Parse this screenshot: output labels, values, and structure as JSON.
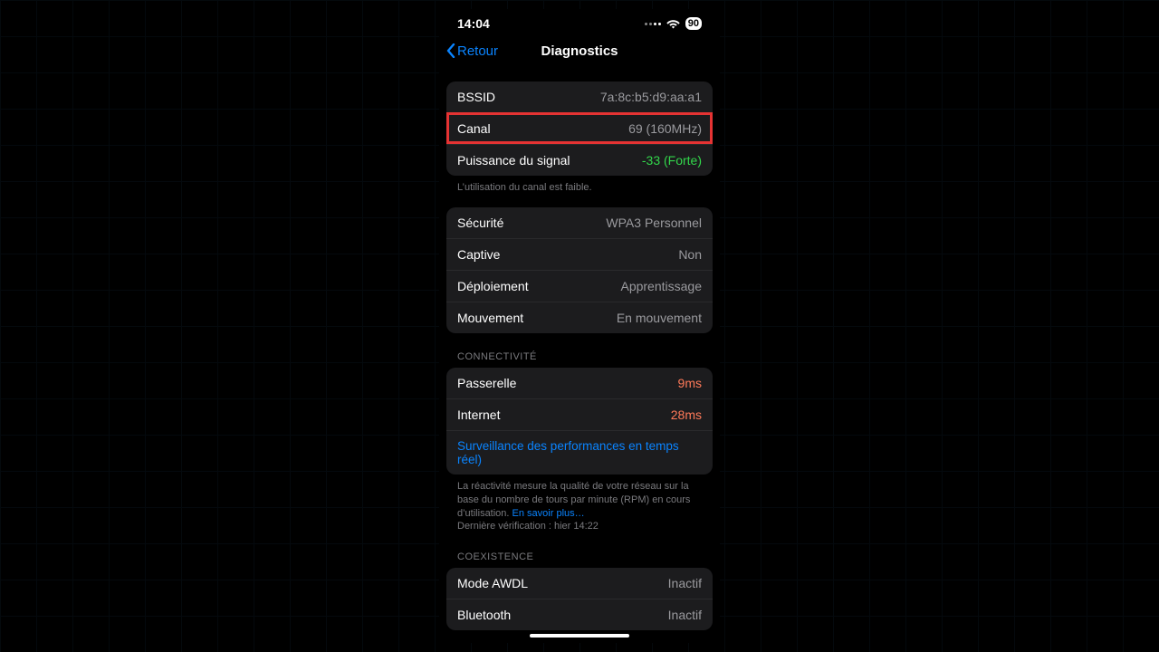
{
  "status": {
    "time": "14:04",
    "battery": "90"
  },
  "nav": {
    "back": "Retour",
    "title": "Diagnostics"
  },
  "group1": {
    "rows": [
      {
        "label": "BSSID",
        "value": "7a:8c:b5:d9:aa:a1"
      },
      {
        "label": "Canal",
        "value": "69 (160MHz)"
      },
      {
        "label": "Puissance du signal",
        "value": "-33 (Forte)"
      }
    ],
    "footer": "L’utilisation du canal est faible."
  },
  "group2": {
    "rows": [
      {
        "label": "Sécurité",
        "value": "WPA3 Personnel"
      },
      {
        "label": "Captive",
        "value": "Non"
      },
      {
        "label": "Déploiement",
        "value": "Apprentissage"
      },
      {
        "label": "Mouvement",
        "value": "En mouvement"
      }
    ]
  },
  "connectivity": {
    "header": "CONNECTIVITÉ",
    "rows": [
      {
        "label": "Passerelle",
        "value": "9ms"
      },
      {
        "label": "Internet",
        "value": "28ms"
      }
    ],
    "link": "Surveillance des performances en temps réel)",
    "footer1": "La réactivité mesure la qualité de votre réseau sur la base du nombre de tours par minute (RPM) en cours d’utilisation.",
    "learn_more": "En savoir plus…",
    "footer2": "Dernière vérification : hier 14:22"
  },
  "coexistence": {
    "header": "COEXISTENCE",
    "rows": [
      {
        "label": "Mode AWDL",
        "value": "Inactif"
      },
      {
        "label": "Bluetooth",
        "value": "Inactif"
      }
    ]
  }
}
